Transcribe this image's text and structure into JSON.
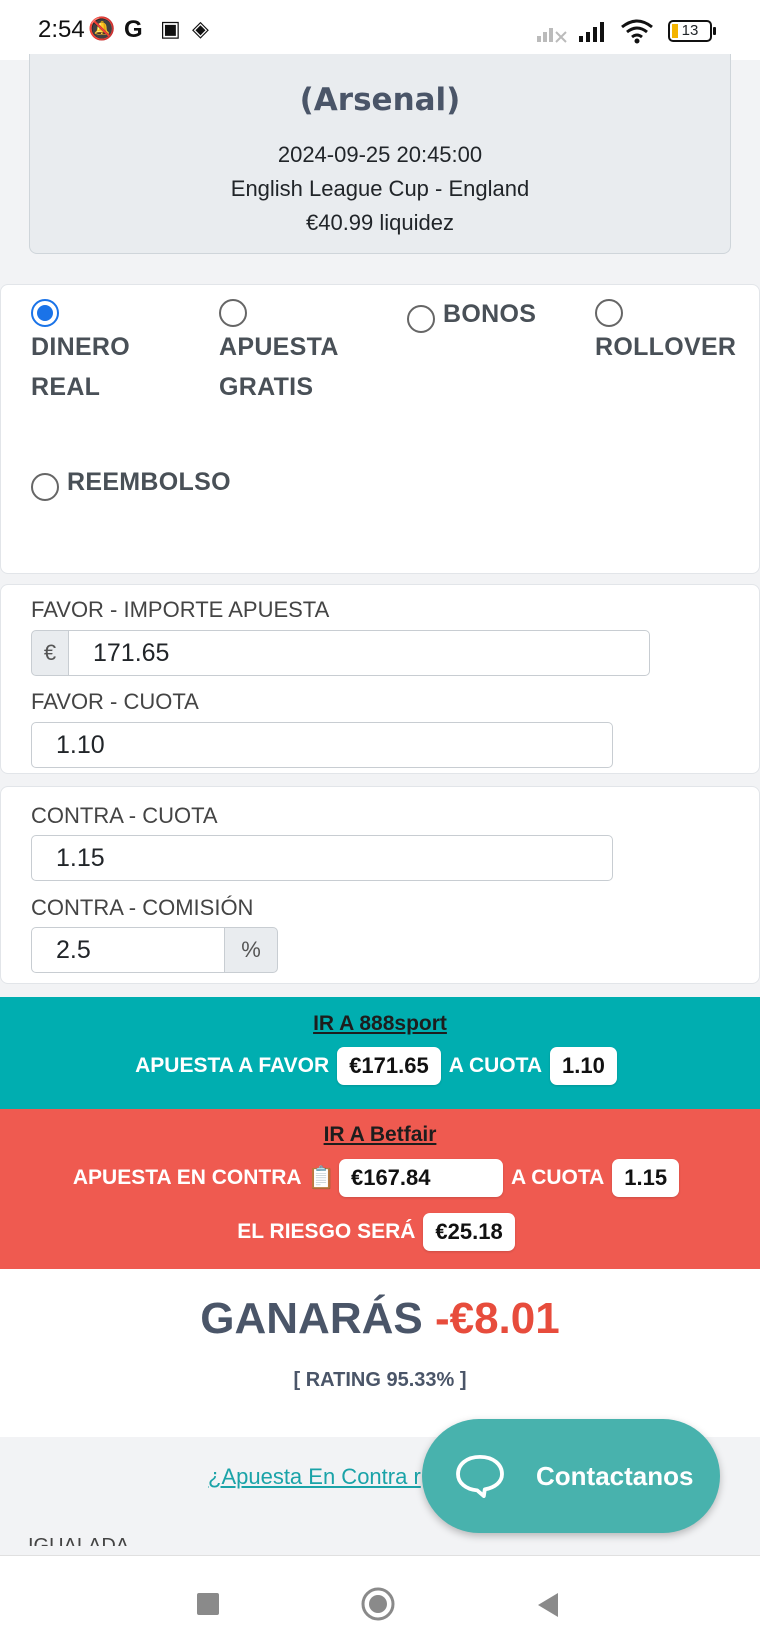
{
  "status_bar": {
    "time": "2:54",
    "battery": "13"
  },
  "event": {
    "team": "(Arsenal)",
    "datetime": "2024-09-25 20:45:00",
    "competition": "English League Cup - England",
    "liquidity": "€40.99 liquidez"
  },
  "bet_types": [
    {
      "label_line1": "DINERO",
      "label_line2": "REAL",
      "selected": true
    },
    {
      "label_line1": "APUESTA",
      "label_line2": "GRATIS",
      "selected": false
    },
    {
      "label_line1": "BONOS",
      "label_line2": "",
      "selected": false
    },
    {
      "label_line1": "",
      "label_line2": "ROLLOVER",
      "selected": false
    },
    {
      "label_line1": "REEMBOLSO",
      "label_line2": "",
      "selected": false
    }
  ],
  "favor": {
    "amount_label": "FAVOR - IMPORTE APUESTA",
    "currency": "€",
    "amount": "171.65",
    "odds_label": "FAVOR - CUOTA",
    "odds": "1.10"
  },
  "contra": {
    "odds_label": "CONTRA - CUOTA",
    "odds": "1.15",
    "commission_label": "CONTRA - COMISIÓN",
    "commission": "2.5",
    "commission_unit": "%"
  },
  "bookmaker": {
    "link": "IR A 888sport",
    "bet_label": "APUESTA A FAVOR",
    "bet_amount": "€171.65",
    "odds_label": "A CUOTA",
    "odds": "1.10",
    "color": "#00aeb0"
  },
  "exchange": {
    "link": "IR A Betfair",
    "bet_label": "APUESTA EN CONTRA",
    "bet_amount": "€167.84",
    "odds_label": "A CUOTA",
    "odds": "1.15",
    "risk_label": "EL RIESGO SERÁ",
    "risk": "€25.18",
    "color": "#ef5a50"
  },
  "result": {
    "label": "GANARÁS",
    "value": "-€8.01",
    "rating": "[ RATING 95.33% ]"
  },
  "links": {
    "contra_question": "¿Apuesta En Contra r",
    "next_section": "IGUALADA"
  },
  "contact_button": {
    "label": "Contactanos"
  }
}
